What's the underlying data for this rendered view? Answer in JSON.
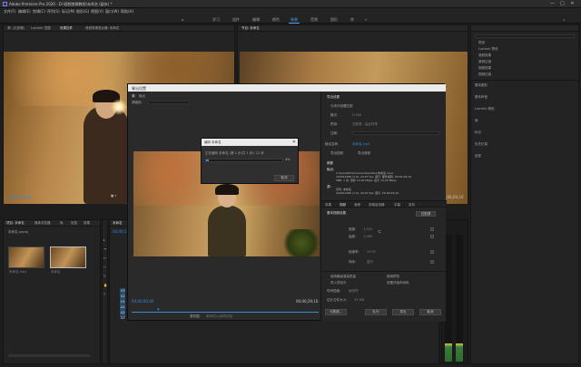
{
  "window": {
    "title": "Adobe Premiere Pro 2020 - D:\\视频剪辑教程\\未命名 (副本) *",
    "controls": [
      "—",
      "□",
      "✕"
    ]
  },
  "menu": [
    "文件(F)",
    "编辑(E)",
    "剪辑(C)",
    "序列(S)",
    "标记(M)",
    "图形(G)",
    "视图(V)",
    "窗口(W)",
    "帮助(H)"
  ],
  "workspace_tabs": [
    {
      "label": "学习"
    },
    {
      "label": "组件"
    },
    {
      "label": "编辑"
    },
    {
      "label": "颜色"
    },
    {
      "label": "效果"
    },
    {
      "label": "音频"
    },
    {
      "label": "图形"
    },
    {
      "label": "库"
    }
  ],
  "source_panel": {
    "tabs": [
      "源: (无剪辑)",
      "Lumetri 范围",
      "效果控件",
      "音频剪辑混合器: 未命名"
    ],
    "timecode_left": "00;00;07;18",
    "timecode_right": "00;00;21;18"
  },
  "program_panel": {
    "tabs": [
      "节目: 未命名"
    ],
    "timecode_right": "00;00;29;10"
  },
  "project_panel": {
    "tabs": [
      "项目: 未命名",
      "媒体浏览器",
      "库",
      "信息",
      "效果"
    ],
    "breadcrumb": "未命名.prproj",
    "items": [
      {
        "name": "未命名.mp4",
        "duration": "29;10"
      },
      {
        "name": "未命名",
        "duration": "29;10"
      }
    ]
  },
  "timeline": {
    "tab": "未命名",
    "timecode": "00;00;11;",
    "tracks": [
      "V3",
      "V2",
      "V1",
      "A1",
      "A2",
      "A3"
    ]
  },
  "effects_panel": {
    "folders": [
      "预设",
      "Lumetri 预设",
      "音频效果",
      "音频过渡",
      "视频效果",
      "视频过渡"
    ],
    "sections": [
      "基本图形",
      "基本声音",
      "Lumetri 颜色",
      "库",
      "标记",
      "历史记录",
      "信息"
    ]
  },
  "export_dialog": {
    "title": "导出设置",
    "tabs": [
      "源",
      "输出"
    ],
    "source_scaling_label": "源缩放:",
    "range_label": "源范围:",
    "range_value": "序列切入/序列切出",
    "in_timecode": "00;00;00;00",
    "out_timecode": "00;00;29;10",
    "settings_title": "导出设置",
    "match_sequence": "与序列设置匹配",
    "format_label": "格式:",
    "format_value": "H.264",
    "preset_label": "预设:",
    "preset_value": "匹配源 - 高比特率",
    "comments_label": "注释:",
    "output_name_label": "输出名称:",
    "output_name_value": "未命名.mp4",
    "export_video": "导出视频",
    "export_audio": "导出音频",
    "summary_title": "摘要",
    "summary_output_label": "输出:",
    "summary_output": "C:\\Users\\Pr\\Documents\\Adobe\\未命名.mp4",
    "summary_output_detail": "1920x1080 (1.0), 29.97 fps, 逐行, 硬件编码, 00;00;29;10",
    "summary_output_audio": "VBR, 1 次, 目标 10.00 Mbps, 最大 12.00 Mbps",
    "summary_source_label": "源:",
    "summary_source": "序列, 未命名",
    "summary_source_detail": "1920x1080 (1.0), 29.97 fps, 逐行, 00;00;29;10",
    "settings_tabs": [
      "效果",
      "视频",
      "音频",
      "多路复用器",
      "字幕",
      "发布"
    ],
    "basic_video_title": "基本视频设置",
    "match_source_button": "匹配源",
    "width_label": "宽度:",
    "width_value": "1,920",
    "height_label": "高度:",
    "height_value": "1,080",
    "frame_rate_label": "帧速率:",
    "frame_rate_value": "29.97",
    "field_order_label": "场序:",
    "field_order_value": "逐行",
    "max_render": "使用最高渲染质量",
    "use_previews": "使用预览",
    "import_project": "导入项目中",
    "set_start_tc": "设置开始时间码",
    "time_interpolation_label": "时间插值:",
    "time_interpolation_value": "帧采样",
    "file_size_label": "估计文件大小:",
    "file_size_value": "35 MB",
    "buttons": [
      "元数据...",
      "队列",
      "导出",
      "取消"
    ]
  },
  "progress_dialog": {
    "title": "编码 未命名",
    "status": "正在编码 未命名 (第 1 步/共 1 步): 12 秒",
    "percent": "4%",
    "progress": 0.04,
    "cancel_label": "取消"
  },
  "colors": {
    "accent": "#2e8de0",
    "bg": "#1d1d1d",
    "panel": "#232323",
    "dialog": "#2a2a2a"
  }
}
